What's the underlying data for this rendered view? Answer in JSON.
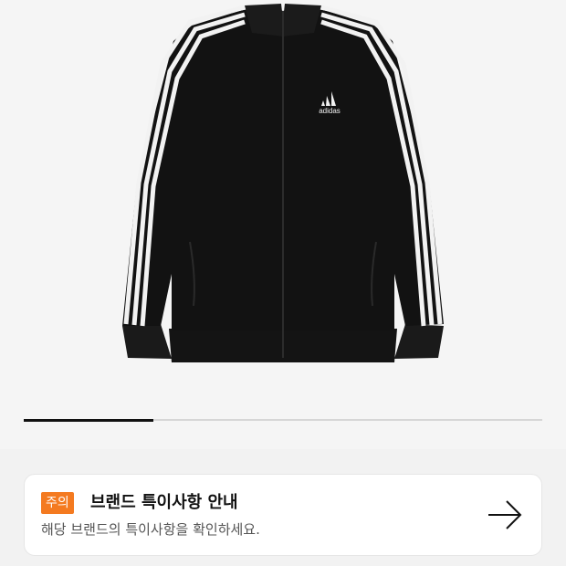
{
  "product": {
    "image_icon": "adidas-track-jacket",
    "brand_logo_text": "adidas",
    "colors": {
      "jacket": "#121212",
      "stripes": "#f2f2f2",
      "background": "#f5f5f5"
    }
  },
  "carousel": {
    "progress": 0.25
  },
  "notice": {
    "badge_label": "주의",
    "title": "브랜드 특이사항 안내",
    "description": "해당 브랜드의 특이사항을 확인하세요.",
    "arrow_icon": "arrow-right-icon",
    "accent_color": "#f47a20"
  }
}
